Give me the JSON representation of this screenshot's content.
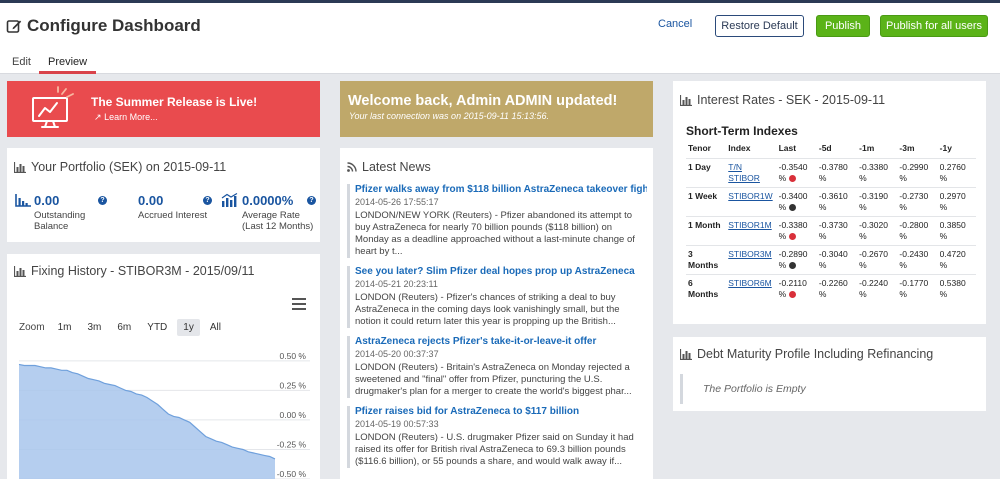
{
  "header": {
    "title": "Configure Dashboard",
    "cancel_label": "Cancel",
    "restore_label": "Restore Default",
    "publish_label": "Publish",
    "publish_all_label": "Publish for all users"
  },
  "tabs": [
    {
      "label": "Edit"
    },
    {
      "label": "Preview"
    }
  ],
  "banner_release": {
    "title": "The Summer Release is Live!",
    "link": "Learn More..."
  },
  "banner_welcome": {
    "title": "Welcome back, Admin ADMIN updated!",
    "subtitle": "Your last connection was on 2015-09-11 15:13:56."
  },
  "portfolio": {
    "title": "Your Portfolio (SEK) on 2015-09-11",
    "outstanding_value": "0.00",
    "outstanding_label_1": "Outstanding",
    "outstanding_label_2": "Balance",
    "accrued_value": "0.00",
    "accrued_label": "Accrued Interest",
    "rate_value": "0.0000%",
    "rate_label_1": "Average Rate",
    "rate_label_2": "(Last 12 Months)"
  },
  "fixing": {
    "title": "Fixing History - STIBOR3M - 2015/09/11",
    "zoom_label": "Zoom",
    "zoom_options": [
      "1m",
      "3m",
      "6m",
      "YTD",
      "1y",
      "All"
    ],
    "zoom_active": "1y"
  },
  "chart_data": {
    "type": "area",
    "title": "",
    "ylabel": "",
    "xlabel": "",
    "yticks": [
      "0.50 %",
      "0.25 %",
      "0.00 %",
      "-0.25 %",
      "-0.50 %"
    ],
    "ylim": [
      -0.5,
      0.6
    ],
    "grid": true,
    "series": [
      {
        "values": [
          0.47,
          0.46,
          0.46,
          0.46,
          0.45,
          0.44,
          0.44,
          0.43,
          0.42,
          0.42,
          0.4,
          0.39,
          0.37,
          0.35,
          0.34,
          0.33,
          0.31,
          0.3,
          0.29,
          0.27,
          0.25,
          0.24,
          0.22,
          0.21,
          0.19,
          0.16,
          0.13,
          0.09,
          0.05,
          0.03,
          0.02,
          0.0,
          -0.02,
          -0.06,
          -0.1,
          -0.14,
          -0.16,
          -0.18,
          -0.19,
          -0.21,
          -0.23,
          -0.24,
          -0.25,
          -0.27,
          -0.28,
          -0.29,
          -0.3,
          -0.31,
          -0.33
        ]
      }
    ]
  },
  "news": {
    "title": "Latest News",
    "items": [
      {
        "title": "Pfizer walks away from $118 billion AstraZeneca takeover fight",
        "date": "2014-05-26 17:55:17",
        "body": "LONDON/NEW YORK (Reuters) - Pfizer abandoned its attempt to buy AstraZeneca for nearly 70 billion pounds ($118 billion) on Monday as a deadline approached without a last-minute change of heart by t..."
      },
      {
        "title": "See you later? Slim Pfizer deal hopes prop up AstraZeneca",
        "date": "2014-05-21 20:23:11",
        "body": "LONDON (Reuters) - Pfizer's chances of striking a deal to buy AstraZeneca in the coming days look vanishingly small, but the notion it could return later this year is propping up the British..."
      },
      {
        "title": "AstraZeneca rejects Pfizer's take-it-or-leave-it offer",
        "date": "2014-05-20 00:37:37",
        "body": "LONDON (Reuters) - Britain's AstraZeneca on Monday rejected a sweetened and \"final\" offer from Pfizer, puncturing the U.S. drugmaker's plan for a merger to create the world's biggest phar..."
      },
      {
        "title": "Pfizer raises bid for AstraZeneca to $117 billion",
        "date": "2014-05-19 00:57:33",
        "body": "LONDON (Reuters) - U.S. drugmaker Pfizer said on Sunday it had raised its offer for British rival AstraZeneca to 69.3 billion pounds ($116.6 billion), or 55 pounds a share, and would walk away if..."
      }
    ]
  },
  "rates": {
    "title": "Interest Rates - SEK - 2015-09-11",
    "subtitle": "Short-Term Indexes",
    "columns": [
      "Tenor",
      "Index",
      "Last",
      "-5d",
      "-1m",
      "-3m",
      "-1y"
    ],
    "rows": [
      {
        "tenor": "1 Day",
        "index": "T/N STIBOR",
        "last": "-0.3540 %",
        "trend": "up",
        "d5": "-0.3780 %",
        "m1": "-0.3380 %",
        "m3": "-0.2990 %",
        "y1": "0.2760 %"
      },
      {
        "tenor": "1 Week",
        "index": "STIBOR1W",
        "last": "-0.3400 %",
        "trend": "down",
        "d5": "-0.3610 %",
        "m1": "-0.3190 %",
        "m3": "-0.2730 %",
        "y1": "0.2970 %"
      },
      {
        "tenor": "1 Month",
        "index": "STIBOR1M",
        "last": "-0.3380 %",
        "trend": "up",
        "d5": "-0.3730 %",
        "m1": "-0.3020 %",
        "m3": "-0.2800 %",
        "y1": "0.3850 %"
      },
      {
        "tenor": "3 Months",
        "index": "STIBOR3M",
        "last": "-0.2890 %",
        "trend": "down",
        "d5": "-0.3040 %",
        "m1": "-0.2670 %",
        "m3": "-0.2430 %",
        "y1": "0.4720 %"
      },
      {
        "tenor": "6 Months",
        "index": "STIBOR6M",
        "last": "-0.2110 %",
        "trend": "up",
        "d5": "-0.2260 %",
        "m1": "-0.2240 %",
        "m3": "-0.1770 %",
        "y1": "0.5380 %"
      }
    ]
  },
  "debt": {
    "title": "Debt Maturity Profile Including Refinancing",
    "empty_text": "The Portfolio is Empty"
  },
  "colors": {
    "accent_red": "#e94b4e",
    "gold": "#bfa86a",
    "link_blue": "#1a55a0",
    "publish_green": "#5bb318",
    "chart_area": "#a8c6ec",
    "chart_line": "#6fa0dc"
  },
  "icons": [
    "edit-icon",
    "monitor-chart-icon",
    "external-link-icon",
    "bar-chart-icon",
    "help-icon",
    "rss-icon",
    "menu-icon",
    "trend-up-icon",
    "trend-down-icon"
  ]
}
